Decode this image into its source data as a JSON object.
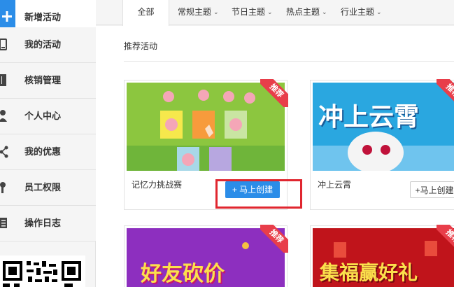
{
  "sidebar": {
    "items": [
      {
        "label": "新增活动",
        "icon": "plus-icon"
      },
      {
        "label": "我的活动",
        "icon": "tablet-icon"
      },
      {
        "label": "核销管理",
        "icon": "book-icon"
      },
      {
        "label": "个人中心",
        "icon": "user-icon"
      },
      {
        "label": "我的优惠",
        "icon": "share-icon"
      },
      {
        "label": "员工权限",
        "icon": "key-icon"
      },
      {
        "label": "操作日志",
        "icon": "list-icon"
      }
    ]
  },
  "tabs": [
    {
      "label": "全部"
    },
    {
      "label": "常规主题"
    },
    {
      "label": "节日主题"
    },
    {
      "label": "热点主题"
    },
    {
      "label": "行业主题"
    }
  ],
  "section": {
    "title": "推荐活动"
  },
  "cards": [
    {
      "name": "记忆力挑战赛",
      "badge": "推荐",
      "button": "马上创建",
      "thumb_text": ""
    },
    {
      "name": "冲上云霄",
      "badge": "推荐",
      "button": "马上创建",
      "thumb_text": "冲上云霄"
    },
    {
      "name": "",
      "badge": "推荐",
      "button": "",
      "thumb_text": "好友砍价"
    },
    {
      "name": "",
      "badge": "推荐",
      "button": "",
      "thumb_text": "集福赢好礼"
    }
  ],
  "colors": {
    "accent": "#2b8de8",
    "badge": "#e83e4a",
    "highlight": "#e0262f"
  }
}
